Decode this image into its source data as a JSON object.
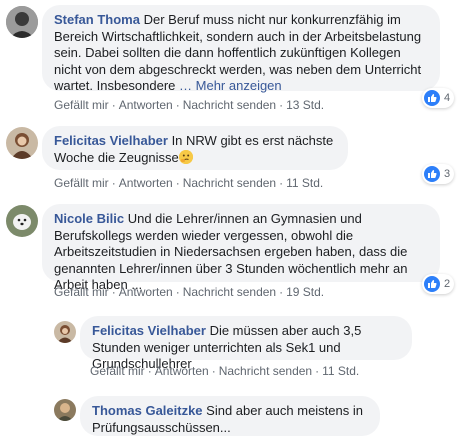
{
  "comments": [
    {
      "author": "Stefan Thoma",
      "text": "Der Beruf muss nicht nur konkurrenzfähig im Bereich Wirtschaftlichkeit, sondern auch in der Arbeitsbelastung sein. Dabei sollten die dann hoffentlich zukünftigen Kollegen nicht von dem abgeschreckt werden, was neben dem Unterricht wartet. Insbesondere",
      "more": "… Mehr anzeigen",
      "actions": {
        "like": "Gefällt mir",
        "reply": "Antworten",
        "message": "Nachricht senden",
        "time": "13 Std."
      },
      "likes": "4"
    },
    {
      "author": "Felicitas Vielhaber",
      "text": "In NRW gibt es erst nächste Woche die Zeugnisse",
      "emoji": "thinking-face-emoji",
      "actions": {
        "like": "Gefällt mir",
        "reply": "Antworten",
        "message": "Nachricht senden",
        "time": "11 Std."
      },
      "likes": "3"
    },
    {
      "author": "Nicole Bilic",
      "text": "Und die Lehrer/innen an Gymnasien und Berufskollegs werden wieder vergessen, obwohl die Arbeitszeitstudien in Niedersachsen ergeben haben, dass die genannten Lehrer/innen über 3 Stunden wöchentlich mehr an Arbeit haben ...",
      "actions": {
        "like": "Gefällt mir",
        "reply": "Antworten",
        "message": "Nachricht senden",
        "time": "19 Std."
      },
      "likes": "2"
    },
    {
      "author": "Felicitas Vielhaber",
      "text": "Die müssen aber auch 3,5 Stunden weniger unterrichten als Sek1 und Grundschullehrer",
      "actions": {
        "like": "Gefällt mir",
        "reply": "Antworten",
        "message": "Nachricht senden",
        "time": "11 Std."
      }
    },
    {
      "author": "Thomas Galeitzke",
      "text": "Sind aber auch meistens in Prüfungsausschüssen..."
    }
  ],
  "colors": {
    "link": "#385898",
    "bubble": "#f2f3f5",
    "like": "#2d7ff9",
    "meta": "#606770"
  }
}
